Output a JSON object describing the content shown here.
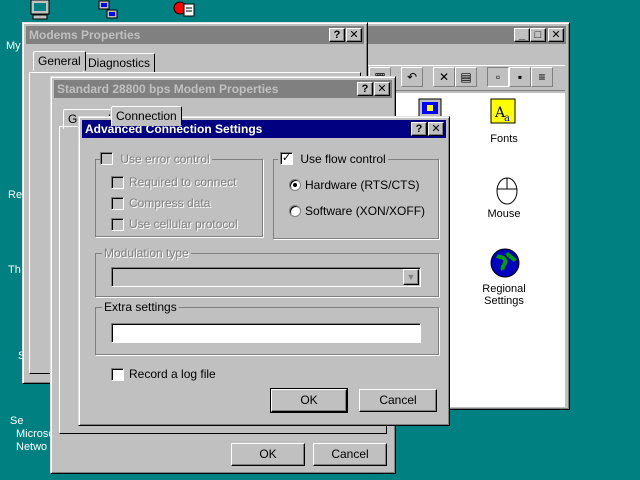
{
  "desktop": {
    "texts": [
      "My",
      "Re",
      "Th",
      "S",
      "Se",
      "Microso",
      "Netwo"
    ]
  },
  "control_panel": {
    "icons": [
      {
        "label": "Fonts"
      },
      {
        "label": "Mouse"
      },
      {
        "label": "Regional Settings"
      }
    ]
  },
  "modems_window": {
    "title": "Modems Properties",
    "tabs": [
      "General",
      "Diagnostics"
    ]
  },
  "modem_props_window": {
    "title": "Standard 28800 bps Modem Properties",
    "tabs": [
      "General",
      "Connection"
    ],
    "ok_label": "OK",
    "cancel_label": "Cancel"
  },
  "advanced": {
    "title": "Advanced Connection Settings",
    "use_error_control": "Use error control",
    "required_to_connect": "Required to connect",
    "compress_data": "Compress data",
    "use_cellular": "Use cellular protocol",
    "use_flow_control": "Use flow control",
    "hardware": "Hardware (RTS/CTS)",
    "software": "Software (XON/XOFF)",
    "modulation_type": "Modulation type",
    "extra_settings": "Extra settings",
    "extra_settings_value": "",
    "record_log": "Record a log file",
    "ok_label": "OK",
    "cancel_label": "Cancel"
  },
  "title_buttons": {
    "help": "?",
    "close": "✕",
    "minimize": "_",
    "maximize": "□"
  }
}
